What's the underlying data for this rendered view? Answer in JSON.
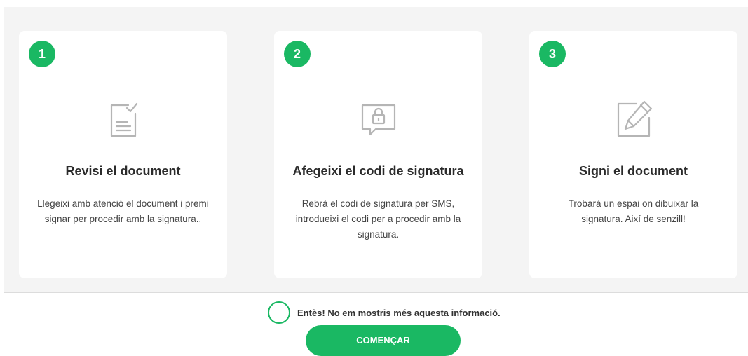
{
  "steps": [
    {
      "number": "1",
      "icon": "document-check-icon",
      "title": "Revisi el document",
      "description": "Llegeixi amb atenció el document i premi signar per procedir amb la signatura.."
    },
    {
      "number": "2",
      "icon": "message-lock-icon",
      "title": "Afegeixi el codi de signatura",
      "description": "Rebrà el codi de signatura per SMS, introdueixi el codi per a procedir amb la signatura."
    },
    {
      "number": "3",
      "icon": "edit-pencil-icon",
      "title": "Signi el document",
      "description": "Trobarà un espai on dibuixar la signatura. Així de senzill!"
    }
  ],
  "confirm": {
    "label": "Entès! No em mostris més aquesta informació."
  },
  "start_button": {
    "label": "COMENÇAR"
  },
  "colors": {
    "accent": "#1ab863",
    "panel_background": "#f4f4f4",
    "card_background": "#ffffff",
    "icon_stroke": "#b5b5b5"
  }
}
